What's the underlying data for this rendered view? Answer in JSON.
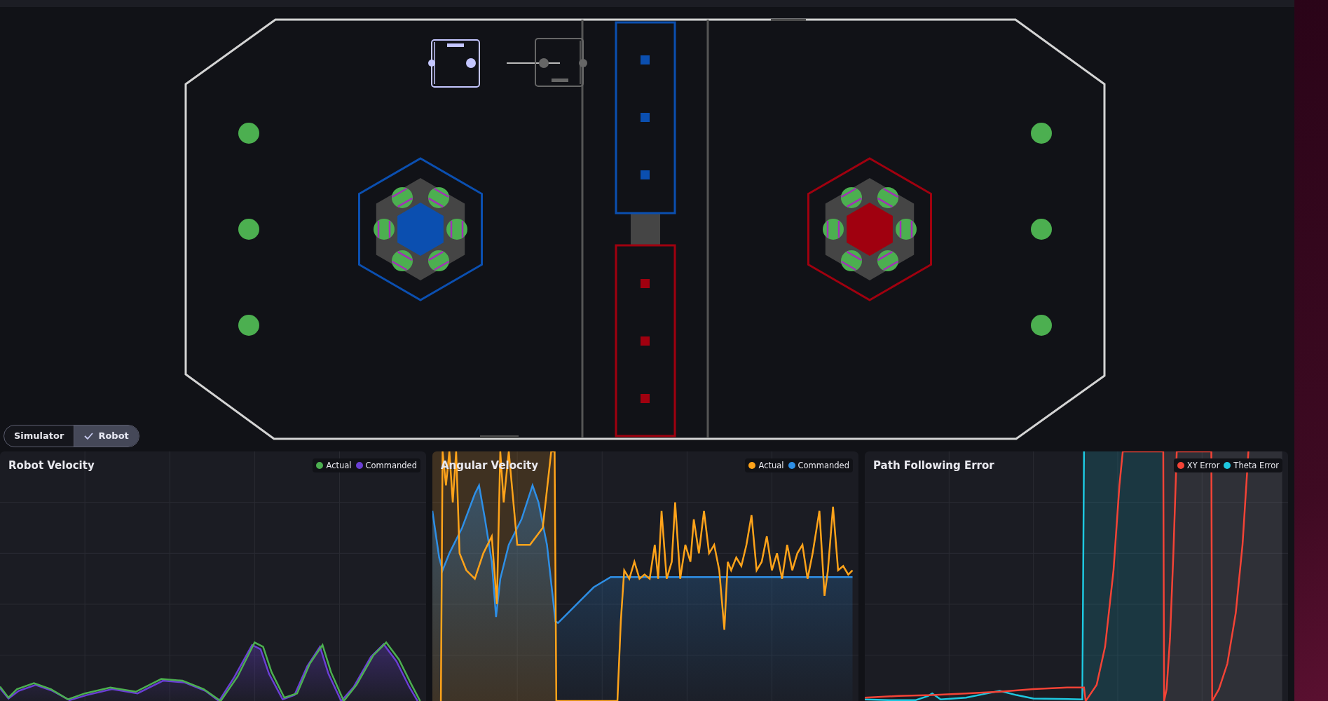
{
  "mode_toggle": [
    {
      "label": "Simulator",
      "selected": false
    },
    {
      "label": "Robot",
      "selected": true
    }
  ],
  "charts": [
    {
      "kind": "velocity",
      "title": "Robot Velocity",
      "legend": [
        {
          "label": "Actual",
          "color": "#4caf50"
        },
        {
          "label": "Commanded",
          "color": "#6a3fd4"
        }
      ]
    },
    {
      "kind": "angular",
      "title": "Angular Velocity",
      "legend": [
        {
          "label": "Actual",
          "color": "#ffa31a"
        },
        {
          "label": "Commanded",
          "color": "#2e8fe6"
        }
      ]
    },
    {
      "kind": "error",
      "title": "Path Following Error",
      "legend": [
        {
          "label": "XY Error",
          "color": "#f44336"
        },
        {
          "label": "Theta Error",
          "color": "#1ec8e0"
        }
      ]
    }
  ]
}
